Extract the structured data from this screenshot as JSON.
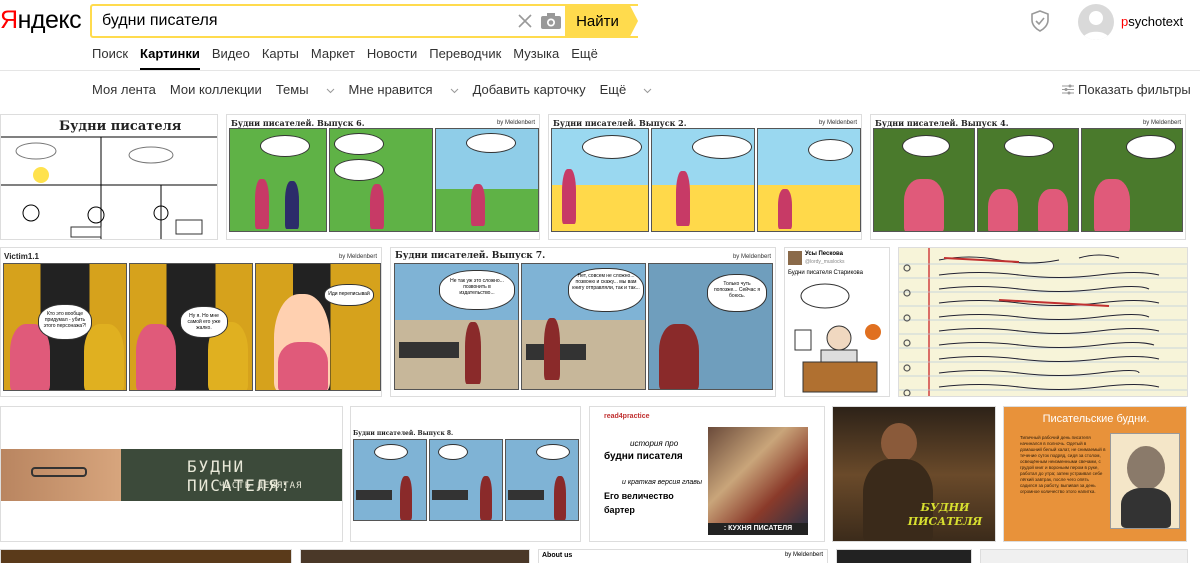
{
  "header": {
    "logo_first": "Я",
    "logo_rest": "ндекс",
    "search_value": "будни писателя",
    "find_label": "Найти",
    "username_first": "p",
    "username_rest": "sychotext"
  },
  "services": [
    "Поиск",
    "Картинки",
    "Видео",
    "Карты",
    "Маркет",
    "Новости",
    "Переводчик",
    "Музыка",
    "Ещё"
  ],
  "active_service": "Картинки",
  "subnav": {
    "items": [
      "Моя лента",
      "Мои коллекции",
      "Темы",
      "Мне нравится",
      "Добавить карточку",
      "Ещё"
    ],
    "filters_label": "Показать фильтры"
  },
  "results": {
    "r1": {
      "t1_title": "Будни писателя",
      "t2_title": "Будни писателей. Выпуск 6.",
      "t3_title": "Будни писателей. Выпуск 2.",
      "t4_title": "Будни писателей. Выпуск 4.",
      "by": "by Meldenbert"
    },
    "r2": {
      "t1_title": "Victim1.1",
      "t1_b1": "Кто это вообще придумал - убить этого персонажа?!",
      "t1_b2": "Ну я. Но мне самой его уже жалко.",
      "t1_b3": "Иди переписывай",
      "t2_title": "Будни писателей. Выпуск 7.",
      "t2_b1": "Не так уж это сложно... позвонить в издательство...",
      "t2_b2": "Нет, совсем не сложно... позвоню и скажу... мы вам книгу отправляли, так и так...",
      "t2_b3": "Только чуть попозже... Сейчас я боюсь.",
      "t3_author": "Усы Пескова",
      "t3_handle": "@lordy_muslocks",
      "t3_caption": "Будни писателя Старикова"
    },
    "r3": {
      "t1_text1": "БУДНИ ПИСАТЕЛЯ:",
      "t1_text2": "ЧАСТЬ ДЕВЯТАЯ",
      "t2_title": "Будни писателей. Выпуск 8.",
      "t3_logo": "read4practice",
      "t3_line1": "история про",
      "t3_line2": "будни писателя",
      "t3_line3": "и краткая версия главы",
      "t3_line4": "Его величество",
      "t3_line5": "бартер",
      "t3_bottom": ": КУХНЯ ПИСАТЕЛЯ",
      "t4_label": "БУДНИ ПИСАТЕЛЯ",
      "t5_title": "Писательские будни.",
      "t5_text": "Типичный рабочий день писателя начинался в полночь. Одетый в домашний белый халат, не снимаемый в течение суток подряд, сидя за столом, освещённым неизменными свечами, с грудой книг и вороньим пером в руке, работал до утра; затем устраивал себе лёгкий завтрак, после чего опять садился за работу, выпивая за день огромное количество этого напитка."
    },
    "r4": {
      "t3_text": "About us"
    }
  },
  "colors": {
    "accent": "#ffdb4d",
    "brand_red": "#ff0000",
    "link": "#333333"
  }
}
